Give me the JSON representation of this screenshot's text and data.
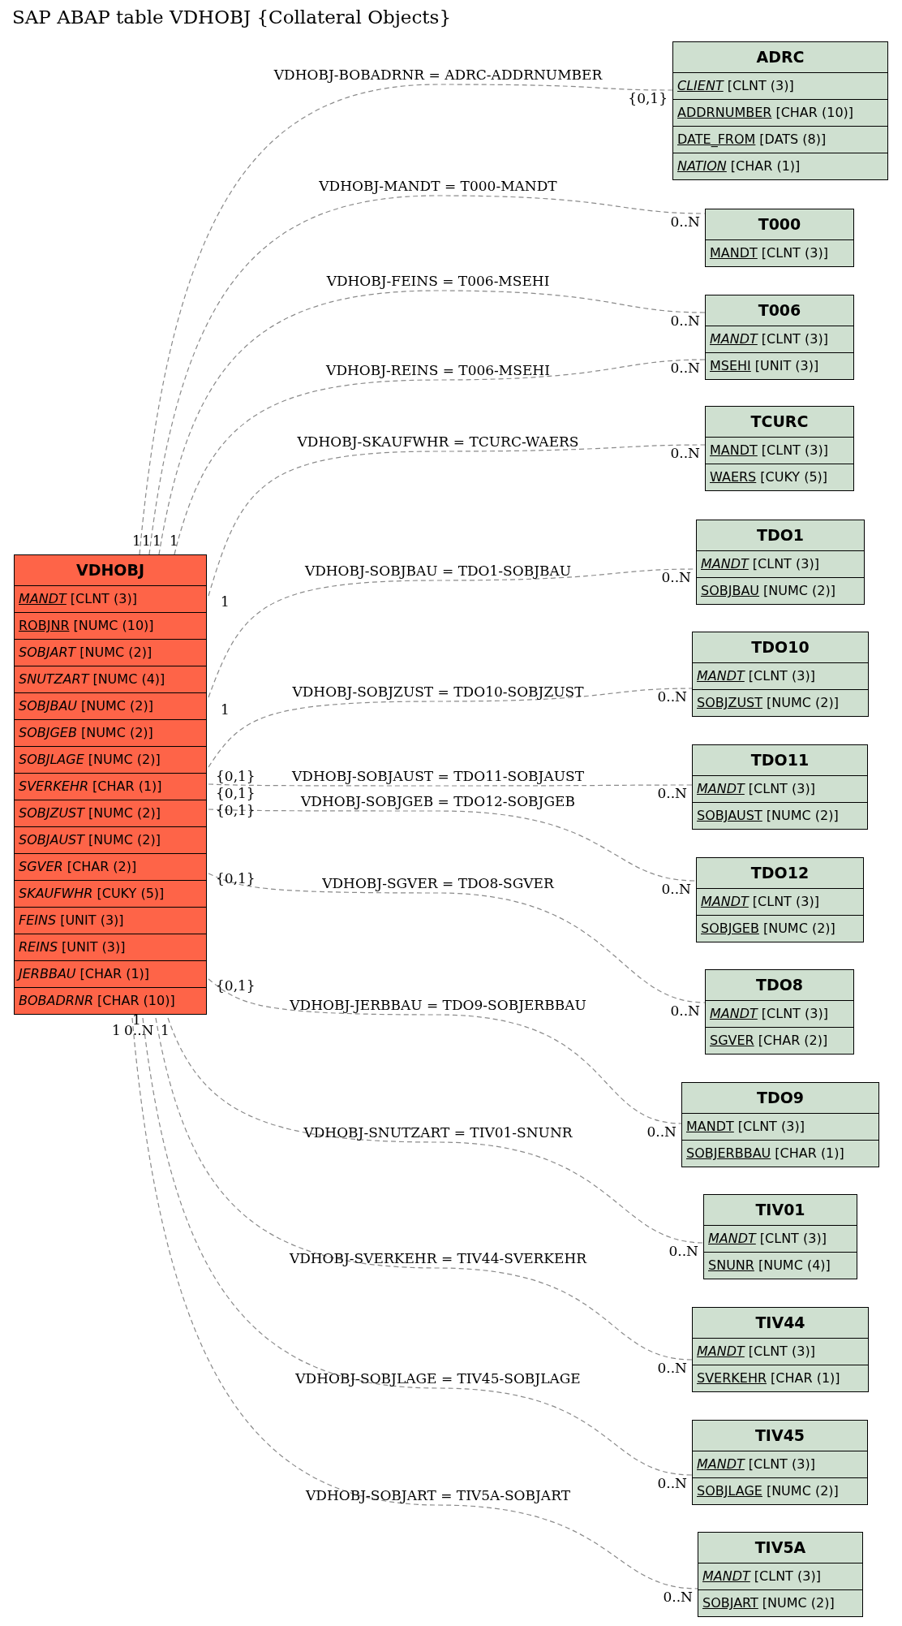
{
  "title": "SAP ABAP table VDHOBJ {Collateral Objects}",
  "main_table": {
    "name": "VDHOBJ",
    "fields": [
      {
        "name": "MANDT",
        "type": "[CLNT (3)]",
        "key": true,
        "italic": true
      },
      {
        "name": "ROBJNR",
        "type": "[NUMC (10)]",
        "key": true,
        "italic": false
      },
      {
        "name": "SOBJART",
        "type": "[NUMC (2)]",
        "key": false,
        "italic": true
      },
      {
        "name": "SNUTZART",
        "type": "[NUMC (4)]",
        "key": false,
        "italic": true
      },
      {
        "name": "SOBJBAU",
        "type": "[NUMC (2)]",
        "key": false,
        "italic": true
      },
      {
        "name": "SOBJGEB",
        "type": "[NUMC (2)]",
        "key": false,
        "italic": true
      },
      {
        "name": "SOBJLAGE",
        "type": "[NUMC (2)]",
        "key": false,
        "italic": true
      },
      {
        "name": "SVERKEHR",
        "type": "[CHAR (1)]",
        "key": false,
        "italic": true
      },
      {
        "name": "SOBJZUST",
        "type": "[NUMC (2)]",
        "key": false,
        "italic": true
      },
      {
        "name": "SOBJAUST",
        "type": "[NUMC (2)]",
        "key": false,
        "italic": true
      },
      {
        "name": "SGVER",
        "type": "[CHAR (2)]",
        "key": false,
        "italic": true
      },
      {
        "name": "SKAUFWHR",
        "type": "[CUKY (5)]",
        "key": false,
        "italic": true
      },
      {
        "name": "FEINS",
        "type": "[UNIT (3)]",
        "key": false,
        "italic": true
      },
      {
        "name": "REINS",
        "type": "[UNIT (3)]",
        "key": false,
        "italic": true
      },
      {
        "name": "JERBBAU",
        "type": "[CHAR (1)]",
        "key": false,
        "italic": true
      },
      {
        "name": "BOBADRNR",
        "type": "[CHAR (10)]",
        "key": false,
        "italic": true
      }
    ]
  },
  "related_tables": [
    {
      "name": "ADRC",
      "fields": [
        {
          "name": "CLIENT",
          "type": "[CLNT (3)]",
          "key": true,
          "italic": true
        },
        {
          "name": "ADDRNUMBER",
          "type": "[CHAR (10)]",
          "key": true,
          "italic": false
        },
        {
          "name": "DATE_FROM",
          "type": "[DATS (8)]",
          "key": true,
          "italic": false
        },
        {
          "name": "NATION",
          "type": "[CHAR (1)]",
          "key": true,
          "italic": true
        }
      ],
      "relations": [
        {
          "label": "VDHOBJ-BOBADRNR = ADRC-ADDRNUMBER",
          "source_cardinality": "1",
          "target_cardinality": "{0,1}"
        }
      ]
    },
    {
      "name": "T000",
      "fields": [
        {
          "name": "MANDT",
          "type": "[CLNT (3)]",
          "key": true,
          "italic": false
        }
      ],
      "relations": [
        {
          "label": "VDHOBJ-MANDT = T000-MANDT",
          "source_cardinality": "1",
          "target_cardinality": "0..N"
        }
      ]
    },
    {
      "name": "T006",
      "fields": [
        {
          "name": "MANDT",
          "type": "[CLNT (3)]",
          "key": true,
          "italic": true
        },
        {
          "name": "MSEHI",
          "type": "[UNIT (3)]",
          "key": true,
          "italic": false
        }
      ],
      "relations": [
        {
          "label": "VDHOBJ-FEINS = T006-MSEHI",
          "source_cardinality": "1",
          "target_cardinality": "0..N"
        },
        {
          "label": "VDHOBJ-REINS = T006-MSEHI",
          "source_cardinality": "1",
          "target_cardinality": "0..N"
        }
      ]
    },
    {
      "name": "TCURC",
      "fields": [
        {
          "name": "MANDT",
          "type": "[CLNT (3)]",
          "key": true,
          "italic": false
        },
        {
          "name": "WAERS",
          "type": "[CUKY (5)]",
          "key": true,
          "italic": false
        }
      ],
      "relations": [
        {
          "label": "VDHOBJ-SKAUFWHR = TCURC-WAERS",
          "source_cardinality": "1",
          "target_cardinality": "0..N"
        }
      ]
    },
    {
      "name": "TDO1",
      "fields": [
        {
          "name": "MANDT",
          "type": "[CLNT (3)]",
          "key": true,
          "italic": true
        },
        {
          "name": "SOBJBAU",
          "type": "[NUMC (2)]",
          "key": true,
          "italic": false
        }
      ],
      "relations": [
        {
          "label": "VDHOBJ-SOBJBAU = TDO1-SOBJBAU",
          "source_cardinality": "1",
          "target_cardinality": "0..N"
        }
      ]
    },
    {
      "name": "TDO10",
      "fields": [
        {
          "name": "MANDT",
          "type": "[CLNT (3)]",
          "key": true,
          "italic": true
        },
        {
          "name": "SOBJZUST",
          "type": "[NUMC (2)]",
          "key": true,
          "italic": false
        }
      ],
      "relations": [
        {
          "label": "VDHOBJ-SOBJZUST = TDO10-SOBJZUST",
          "source_cardinality": "{0,1}",
          "target_cardinality": "0..N"
        }
      ]
    },
    {
      "name": "TDO11",
      "fields": [
        {
          "name": "MANDT",
          "type": "[CLNT (3)]",
          "key": true,
          "italic": true
        },
        {
          "name": "SOBJAUST",
          "type": "[NUMC (2)]",
          "key": true,
          "italic": false
        }
      ],
      "relations": [
        {
          "label": "VDHOBJ-SOBJAUST = TDO11-SOBJAUST",
          "source_cardinality": "{0,1}",
          "target_cardinality": "0..N"
        }
      ]
    },
    {
      "name": "TDO12",
      "fields": [
        {
          "name": "MANDT",
          "type": "[CLNT (3)]",
          "key": true,
          "italic": true
        },
        {
          "name": "SOBJGEB",
          "type": "[NUMC (2)]",
          "key": true,
          "italic": false
        }
      ],
      "relations": [
        {
          "label": "VDHOBJ-SOBJGEB = TDO12-SOBJGEB",
          "source_cardinality": "{0,1}",
          "target_cardinality": "0..N"
        }
      ]
    },
    {
      "name": "TDO8",
      "fields": [
        {
          "name": "MANDT",
          "type": "[CLNT (3)]",
          "key": true,
          "italic": true
        },
        {
          "name": "SGVER",
          "type": "[CHAR (2)]",
          "key": true,
          "italic": false
        }
      ],
      "relations": [
        {
          "label": "VDHOBJ-SGVER = TDO8-SGVER",
          "source_cardinality": "{0,1}",
          "target_cardinality": "0..N"
        }
      ]
    },
    {
      "name": "TDO9",
      "fields": [
        {
          "name": "MANDT",
          "type": "[CLNT (3)]",
          "key": true,
          "italic": false
        },
        {
          "name": "SOBJERBBAU",
          "type": "[CHAR (1)]",
          "key": true,
          "italic": false
        }
      ],
      "relations": [
        {
          "label": "VDHOBJ-JERBBAU = TDO9-SOBJERBBAU",
          "source_cardinality": "{0,1}",
          "target_cardinality": "0..N"
        }
      ]
    },
    {
      "name": "TIV01",
      "fields": [
        {
          "name": "MANDT",
          "type": "[CLNT (3)]",
          "key": true,
          "italic": true
        },
        {
          "name": "SNUNR",
          "type": "[NUMC (4)]",
          "key": true,
          "italic": false
        }
      ],
      "relations": [
        {
          "label": "VDHOBJ-SNUTZART = TIV01-SNUNR",
          "source_cardinality": "1",
          "target_cardinality": "0..N"
        }
      ]
    },
    {
      "name": "TIV44",
      "fields": [
        {
          "name": "MANDT",
          "type": "[CLNT (3)]",
          "key": true,
          "italic": true
        },
        {
          "name": "SVERKEHR",
          "type": "[CHAR (1)]",
          "key": true,
          "italic": false
        }
      ],
      "relations": [
        {
          "label": "VDHOBJ-SVERKEHR = TIV44-SVERKEHR",
          "source_cardinality": "0..N",
          "target_cardinality": "0..N"
        }
      ]
    },
    {
      "name": "TIV45",
      "fields": [
        {
          "name": "MANDT",
          "type": "[CLNT (3)]",
          "key": true,
          "italic": true
        },
        {
          "name": "SOBJLAGE",
          "type": "[NUMC (2)]",
          "key": true,
          "italic": false
        }
      ],
      "relations": [
        {
          "label": "VDHOBJ-SOBJLAGE = TIV45-SOBJLAGE",
          "source_cardinality": "1",
          "target_cardinality": "0..N"
        }
      ]
    },
    {
      "name": "TIV5A",
      "fields": [
        {
          "name": "MANDT",
          "type": "[CLNT (3)]",
          "key": true,
          "italic": true
        },
        {
          "name": "SOBJART",
          "type": "[NUMC (2)]",
          "key": true,
          "italic": false
        }
      ],
      "relations": [
        {
          "label": "VDHOBJ-SOBJART = TIV5A-SOBJART",
          "source_cardinality": "1",
          "target_cardinality": "0..N"
        }
      ]
    }
  ]
}
